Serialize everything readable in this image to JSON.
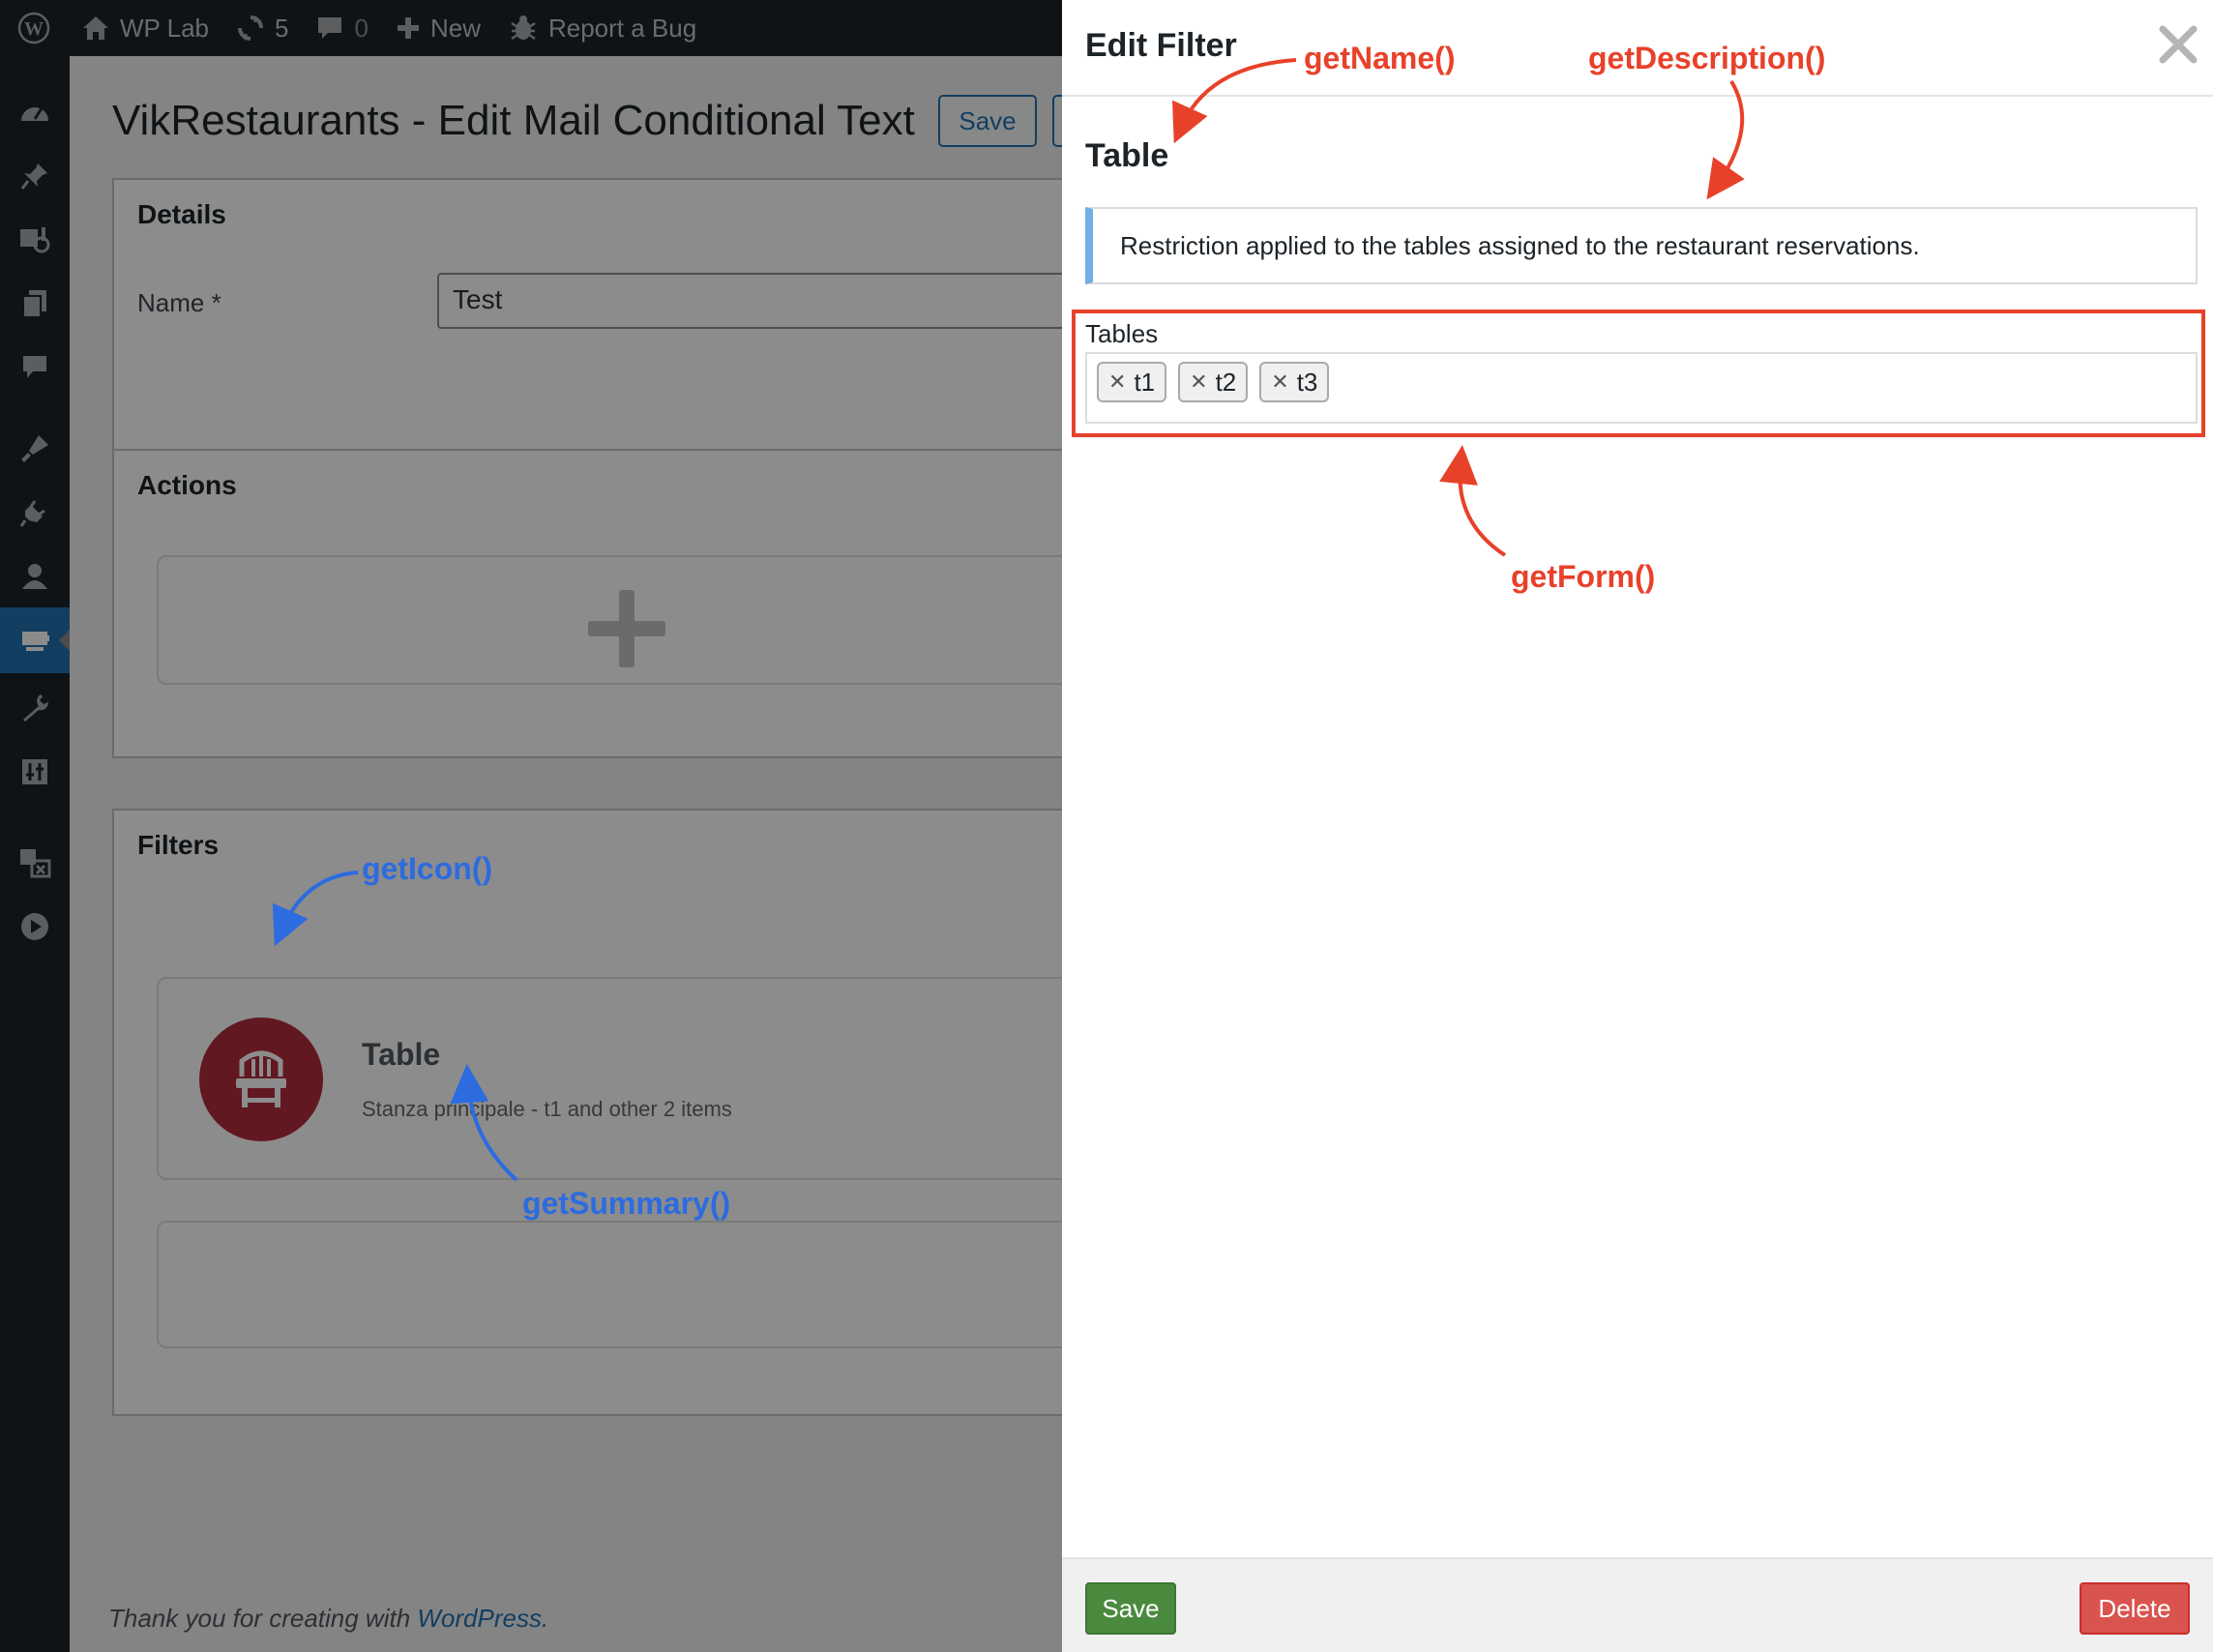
{
  "admin_bar": {
    "site_name": "WP Lab",
    "updates_count": "5",
    "comments_count": "0",
    "new_label": "New",
    "report_bug_label": "Report a Bug"
  },
  "admin_menu": {
    "icons": [
      "dashboard-icon",
      "pin-icon",
      "media-icon",
      "pages-icon",
      "comments-icon",
      "appearance-icon",
      "plugins-icon",
      "users-icon",
      "vikrestaurants-icon",
      "tools-icon",
      "settings-icon",
      "translate-icon",
      "play-icon"
    ],
    "active": "vikrestaurants-icon"
  },
  "page": {
    "title": "VikRestaurants - Edit Mail Conditional Text",
    "save_label": "Save",
    "details": {
      "title": "Details",
      "name_label": "Name *",
      "name_value": "Test"
    },
    "actions": {
      "title": "Actions"
    },
    "filters": {
      "title": "Filters",
      "items": [
        {
          "name": "Table",
          "summary": "Stanza principale - t1 and other 2 items",
          "icon_color": "#b32d3c"
        }
      ]
    },
    "footer": {
      "prefix": "Thank you for creating with ",
      "link": "WordPress",
      "suffix": "."
    }
  },
  "panel": {
    "title": "Edit Filter",
    "filter_name": "Table",
    "description": "Restriction applied to the tables assigned to the restaurant reservations.",
    "tables_label": "Tables",
    "tags": [
      "t1",
      "t2",
      "t3"
    ],
    "save_label": "Save",
    "delete_label": "Delete"
  },
  "annotations": {
    "get_name": "getName()",
    "get_description": "getDescription()",
    "get_form": "getForm()",
    "get_icon": "getIcon()",
    "get_summary": "getSummary()",
    "red_color": "#e8412a",
    "blue_color": "#2c6be0"
  }
}
